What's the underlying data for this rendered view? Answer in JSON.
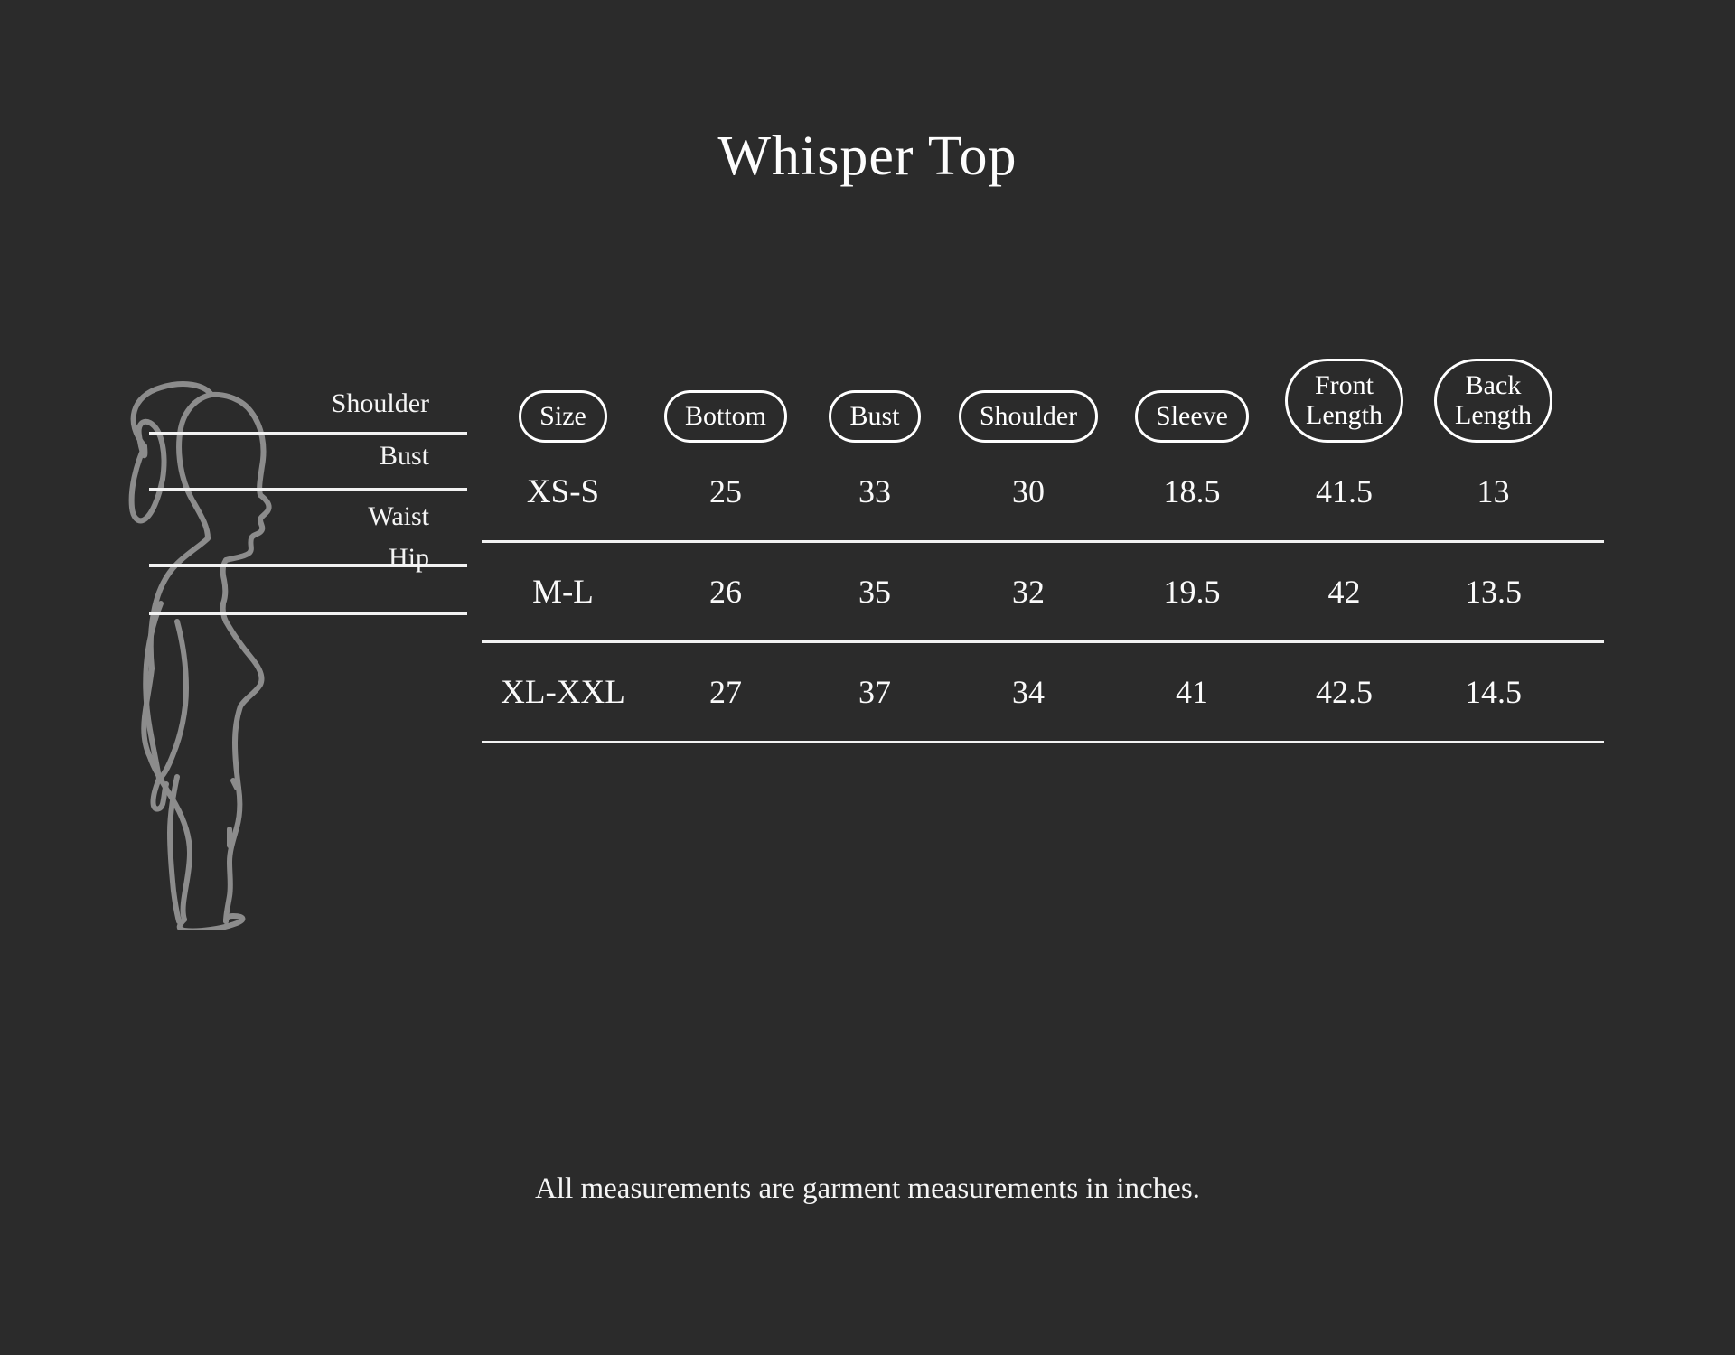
{
  "title": "Whisper Top",
  "footnote": "All measurements are garment measurements in inches.",
  "colors": {
    "background": "#2b2b2b",
    "text": "#ffffff",
    "rule": "#f2f2f2",
    "figure_stroke": "#8c8c8c"
  },
  "figure": {
    "name": "female-side-profile-silhouette",
    "labels": [
      {
        "text": "Shoulder"
      },
      {
        "text": "Bust"
      },
      {
        "text": "Waist"
      },
      {
        "text": "Hip"
      }
    ]
  },
  "table": {
    "headers": [
      {
        "label": "Size",
        "lines": [
          "Size"
        ]
      },
      {
        "label": "Bottom",
        "lines": [
          "Bottom"
        ]
      },
      {
        "label": "Bust",
        "lines": [
          "Bust"
        ]
      },
      {
        "label": "Shoulder",
        "lines": [
          "Shoulder"
        ]
      },
      {
        "label": "Sleeve",
        "lines": [
          "Sleeve"
        ]
      },
      {
        "label": "Front Length",
        "lines": [
          "Front",
          "Length"
        ]
      },
      {
        "label": "Back Length",
        "lines": [
          "Back",
          "Length"
        ]
      }
    ],
    "rows": [
      {
        "size": "XS-S",
        "bottom": "25",
        "bust": "33",
        "shoulder": "30",
        "sleeve": "18.5",
        "front_length": "41.5",
        "back_length": "13"
      },
      {
        "size": "M-L",
        "bottom": "26",
        "bust": "35",
        "shoulder": "32",
        "sleeve": "19.5",
        "front_length": "42",
        "back_length": "13.5"
      },
      {
        "size": "XL-XXL",
        "bottom": "27",
        "bust": "37",
        "shoulder": "34",
        "sleeve": "41",
        "front_length": "42.5",
        "back_length": "14.5"
      }
    ]
  }
}
